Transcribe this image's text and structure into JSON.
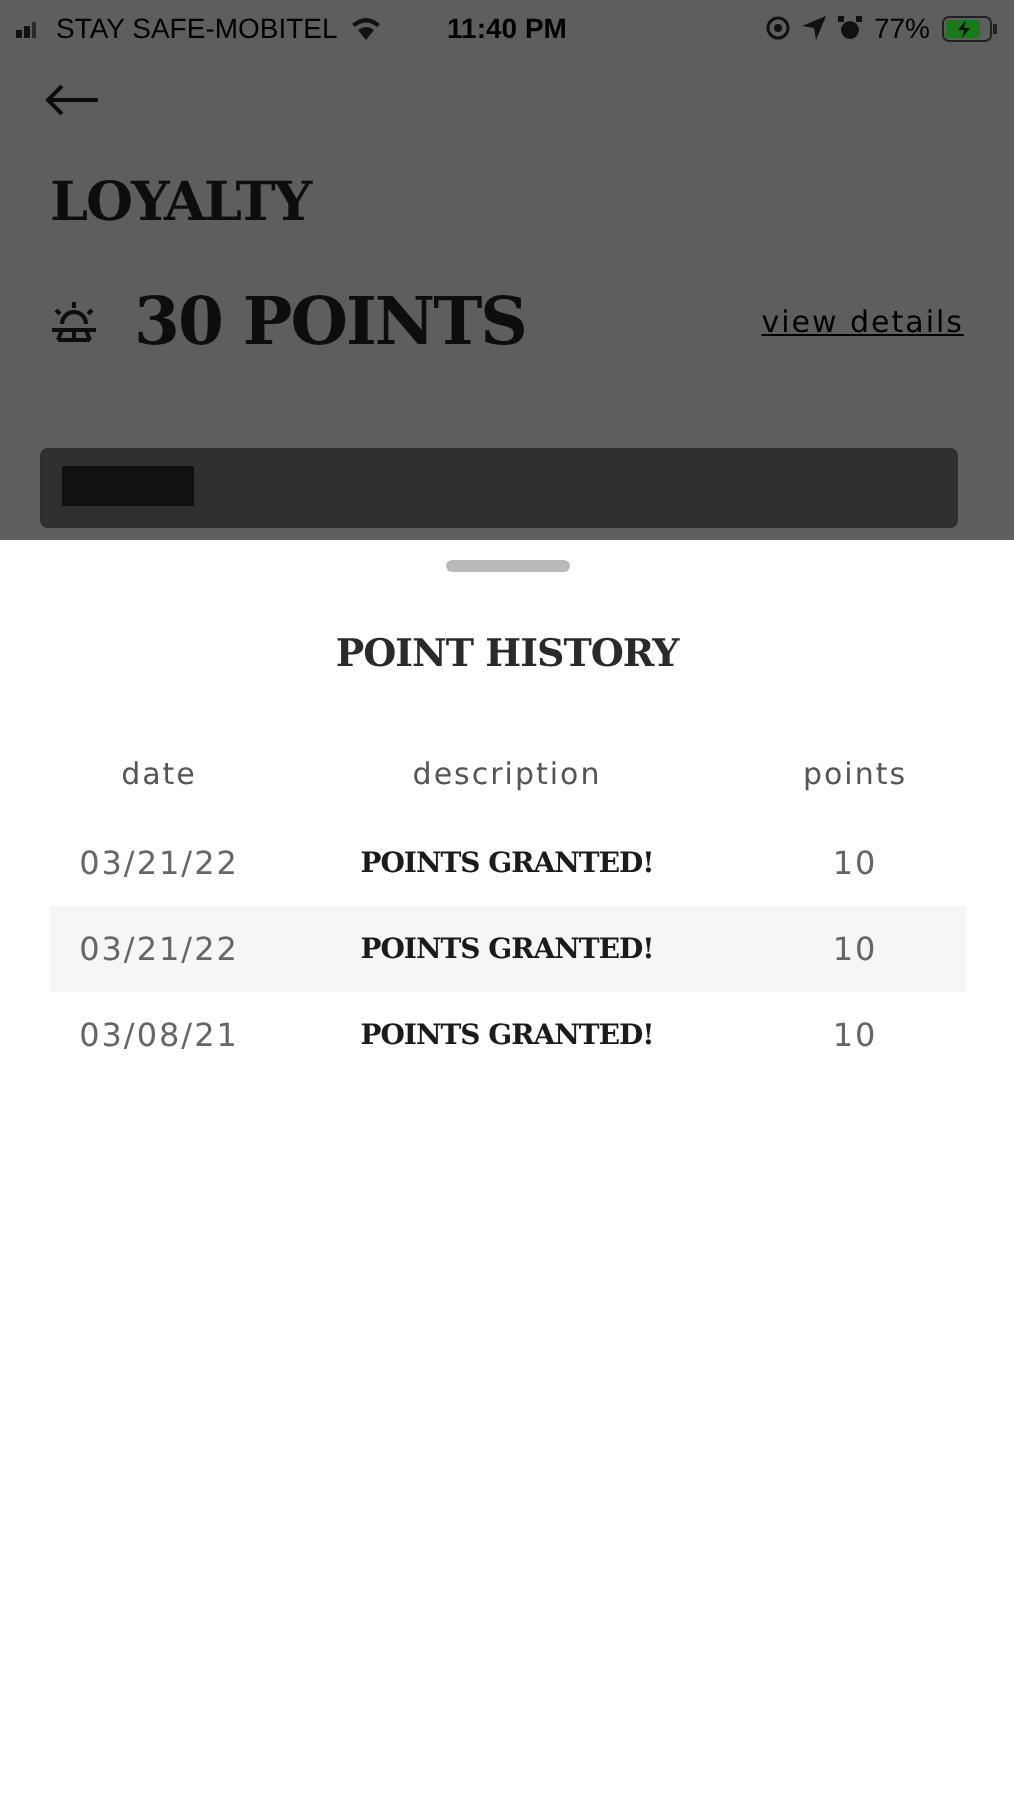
{
  "status_bar": {
    "carrier": "STAY SAFE-MOBITEL",
    "time": "11:40 PM",
    "battery": "77%"
  },
  "page": {
    "title": "LOYALTY",
    "points": "30 POINTS",
    "link": "view details"
  },
  "sheet": {
    "title": "POINT HISTORY",
    "columns": [
      "date",
      "description",
      "points"
    ],
    "rows": [
      {
        "date": "03/21/22",
        "description": "POINTS GRANTED!",
        "points": "10"
      },
      {
        "date": "03/21/22",
        "description": "POINTS GRANTED!",
        "points": "10"
      },
      {
        "date": "03/08/21",
        "description": "POINTS GRANTED!",
        "points": "10"
      }
    ]
  }
}
